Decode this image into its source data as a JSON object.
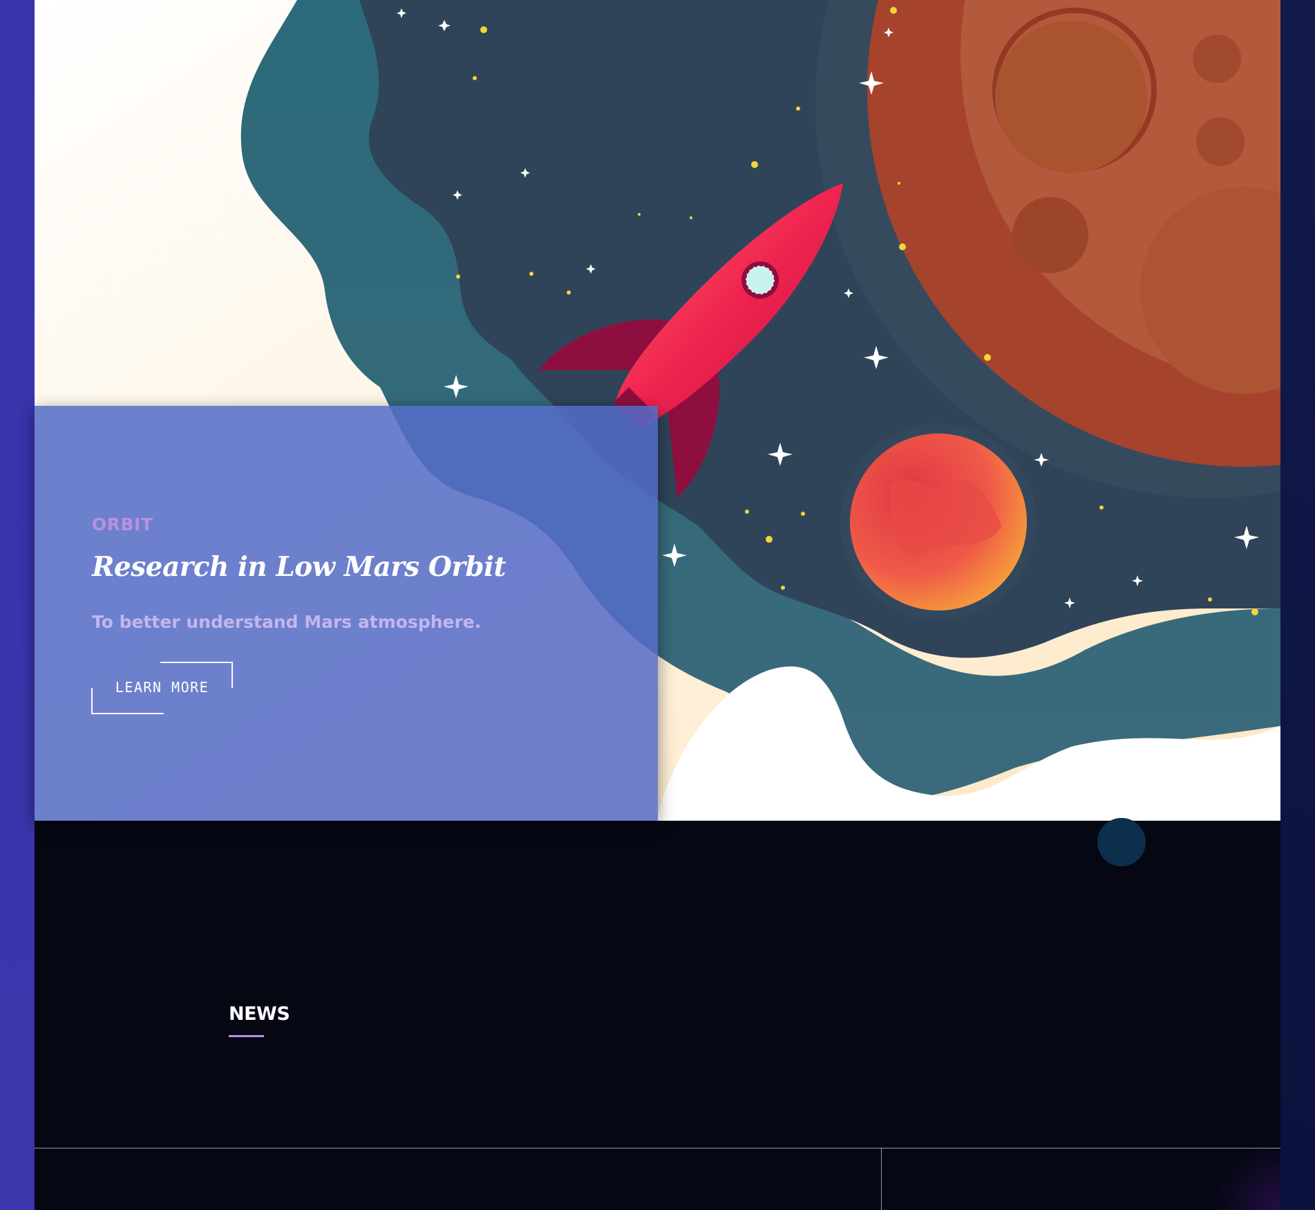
{
  "hero_card": {
    "eyebrow": "ORBIT",
    "title": "Research in Low Mars Orbit",
    "subtitle": "To better understand Mars atmosphere.",
    "cta_label": "LEARN MORE"
  },
  "news": {
    "heading": "NEWS"
  },
  "icons": {
    "illustration": "rocket-space-illustration",
    "planet_large": "mars-icon",
    "planet_small": "red-planet-icon",
    "rocket": "rocket-icon"
  },
  "colors": {
    "left_rail": "#3a33ae",
    "right_rail": "#0f1846",
    "space": "#2f4459",
    "card": "#556cc8",
    "accent": "#b891e0",
    "page_bg": "#050713"
  }
}
